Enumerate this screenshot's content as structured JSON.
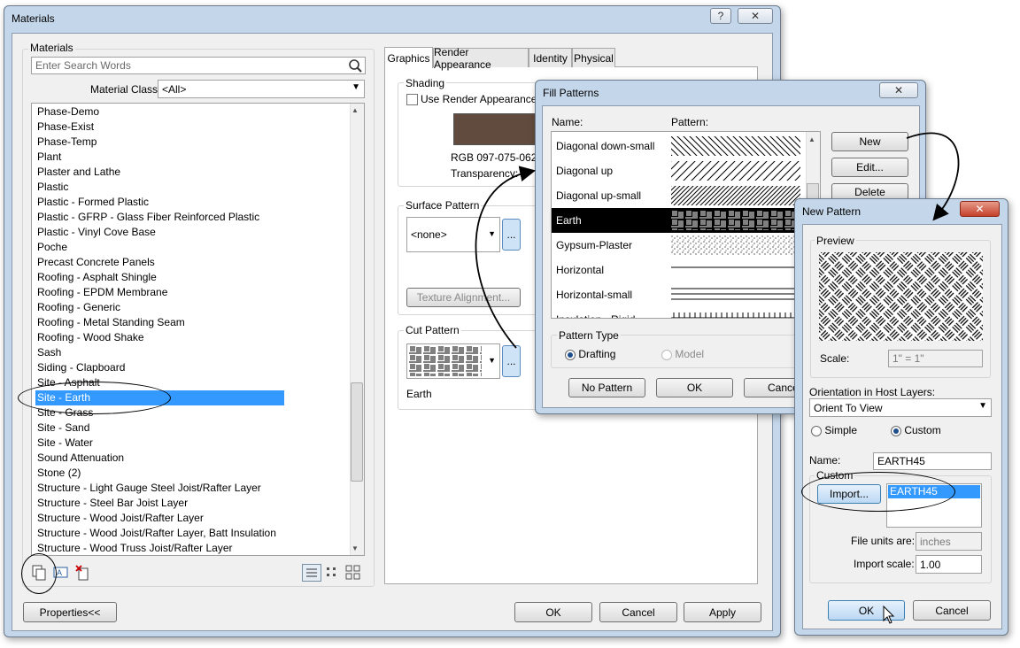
{
  "materials": {
    "title": "Materials",
    "help_label": "?",
    "close_label": "✕",
    "group_label": "Materials",
    "search_placeholder": "Enter Search Words",
    "class_label": "Material Class:",
    "class_value": "<All>",
    "items": [
      "Phase-Demo",
      "Phase-Exist",
      "Phase-Temp",
      "Plant",
      "Plaster and Lathe",
      "Plastic",
      "Plastic - Formed Plastic",
      "Plastic - GFRP -  Glass Fiber Reinforced Plastic",
      "Plastic - Vinyl Cove Base",
      "Poche",
      "Precast Concrete Panels",
      "Roofing - Asphalt Shingle",
      "Roofing - EPDM Membrane",
      "Roofing - Generic",
      "Roofing - Metal Standing Seam",
      "Roofing - Wood Shake",
      "Sash",
      "Siding - Clapboard",
      "Site - Asphalt",
      "Site - Earth",
      "Site - Grass",
      "Site - Sand",
      "Site - Water",
      "Sound Attenuation",
      "Stone (2)",
      "Structure - Light Gauge Steel Joist/Rafter Layer",
      "Structure - Steel Bar Joist Layer",
      "Structure - Wood Joist/Rafter Layer",
      "Structure - Wood Joist/Rafter Layer, Batt Insulation",
      "Structure - Wood Truss Joist/Rafter Layer"
    ],
    "selected_index": 19,
    "tabs": [
      "Graphics",
      "Render Appearance",
      "Identity",
      "Physical"
    ],
    "shading_label": "Shading",
    "use_render_label": "Use Render Appearance fo",
    "rgb_label": "RGB 097-075-062",
    "transparency_label": "Transparency:",
    "surface_pattern_label": "Surface Pattern",
    "surface_pattern_value": "<none>",
    "texture_alignment_label": "Texture Alignment...",
    "cut_pattern_label": "Cut Pattern",
    "cut_pattern_name": "Earth",
    "ellipsis": "...",
    "properties_label": "Properties<<",
    "ok_label": "OK",
    "cancel_label": "Cancel",
    "apply_label": "Apply",
    "shading_color": "#614b3e"
  },
  "fill_patterns": {
    "title": "Fill Patterns",
    "close_label": "✕",
    "col_name": "Name:",
    "col_pattern": "Pattern:",
    "rows": [
      "Diagonal down-small",
      "Diagonal up",
      "Diagonal up-small",
      "Earth",
      "Gypsum-Plaster",
      "Horizontal",
      "Horizontal-small",
      "Insulation - Rigid"
    ],
    "selected_index": 3,
    "new_label": "New",
    "edit_label": "Edit...",
    "delete_label": "Delete",
    "pattern_type_label": "Pattern Type",
    "drafting_label": "Drafting",
    "model_label": "Model",
    "no_pattern_label": "No Pattern",
    "ok_label": "OK",
    "cancel_label": "Cance"
  },
  "new_pattern": {
    "title": "New Pattern",
    "close_label": "✕",
    "preview_label": "Preview",
    "scale_label": "Scale:",
    "scale_value": "1\" = 1\"",
    "orientation_label": "Orientation in Host Layers:",
    "orientation_value": "Orient To View",
    "simple_label": "Simple",
    "custom_label": "Custom",
    "name_label": "Name:",
    "name_value": "EARTH45",
    "custom_group_label": "Custom",
    "import_label": "Import...",
    "import_item": "EARTH45",
    "file_units_label": "File units are:",
    "file_units_value": "inches",
    "import_scale_label": "Import scale:",
    "import_scale_value": "1.00",
    "ok_label": "OK",
    "cancel_label": "Cancel"
  }
}
